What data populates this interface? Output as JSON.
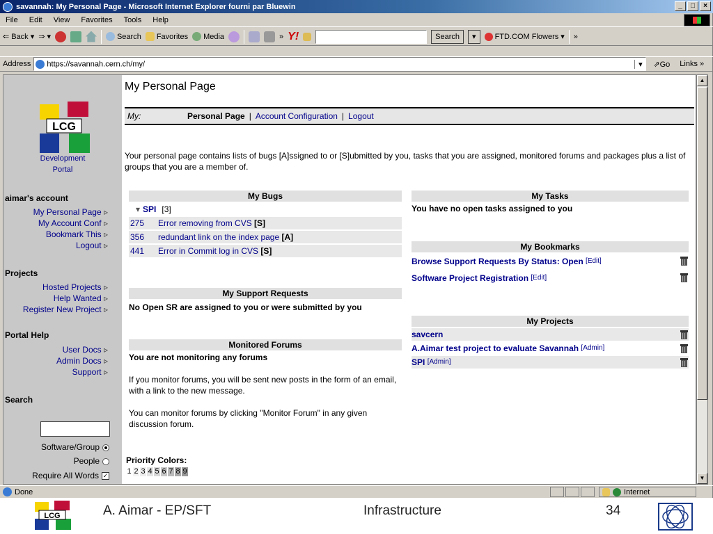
{
  "window": {
    "title": "savannah: My Personal Page - Microsoft Internet Explorer fourni par Bluewin",
    "menu": [
      "File",
      "Edit",
      "View",
      "Favorites",
      "Tools",
      "Help"
    ],
    "toolbar": {
      "back": "Back",
      "search": "Search",
      "favorites": "Favorites",
      "media": "Media",
      "search_button": "Search",
      "flowers": "FTD.COM Flowers"
    },
    "address_label": "Address",
    "address": "https://savannah.cern.ch/my/",
    "go": "Go",
    "links": "Links",
    "status": "Done",
    "zone": "Internet"
  },
  "sidebar": {
    "portal": [
      "Development",
      "Portal"
    ],
    "account_heading": "aimar's account",
    "account_links": [
      "My Personal Page",
      "My Account Conf",
      "Bookmark This",
      "Logout"
    ],
    "projects_heading": "Projects",
    "project_links": [
      "Hosted Projects",
      "Help Wanted",
      "Register New Project"
    ],
    "help_heading": "Portal Help",
    "help_links": [
      "User Docs",
      "Admin Docs",
      "Support"
    ],
    "search_heading": "Search",
    "search_options": [
      "Software/Group",
      "People",
      "Require All Words"
    ]
  },
  "main": {
    "title": "My Personal Page",
    "nav": {
      "label": "My:",
      "current": "Personal Page",
      "links": [
        "Account Configuration",
        "Logout"
      ]
    },
    "intro": "Your personal page contains lists of bugs [A]ssigned to or [S]ubmitted by you, tasks that you are assigned, monitored forums and packages plus a list of groups that you are a member of.",
    "bugs": {
      "heading": "My Bugs",
      "group": "SPI",
      "count": "[3]",
      "rows": [
        {
          "id": "275",
          "text": "Error removing from CVS",
          "tag": "[S]"
        },
        {
          "id": "356",
          "text": "redundant link on the index page",
          "tag": "[A]"
        },
        {
          "id": "441",
          "text": "Error in Commit log in CVS",
          "tag": "[S]"
        }
      ]
    },
    "support": {
      "heading": "My Support Requests",
      "text": "No Open SR are assigned to you or were submitted by you"
    },
    "forums": {
      "heading": "Monitored Forums",
      "text": "You are not monitoring any forums",
      "p1": "If you monitor forums, you will be sent new posts in the form of an email, with a link to the new message.",
      "p2": "You can monitor forums by clicking \"Monitor Forum\" in any given discussion forum."
    },
    "priority": {
      "label": "Priority Colors:",
      "levels": [
        "1",
        "2",
        "3",
        "4",
        "5",
        "6",
        "7",
        "8",
        "9"
      ]
    },
    "tasks": {
      "heading": "My Tasks",
      "text": "You have no open tasks assigned to you"
    },
    "bookmarks": {
      "heading": "My Bookmarks",
      "items": [
        {
          "text": "Browse Support Requests By Status: Open",
          "edit": "[Edit]"
        },
        {
          "text": "Software Project Registration",
          "edit": "[Edit]"
        }
      ]
    },
    "projects": {
      "heading": "My Projects",
      "items": [
        {
          "text": "savcern",
          "admin": ""
        },
        {
          "text": "A.Aimar test project to evaluate Savannah",
          "admin": "[Admin]"
        },
        {
          "text": "SPI",
          "admin": "[Admin]"
        }
      ]
    }
  },
  "footer": {
    "author": "A. Aimar - EP/SFT",
    "topic": "Infrastructure",
    "page": "34"
  },
  "colors": {
    "link": "#00008b",
    "title_bar": "#0a246a",
    "sidebar_bg": "#c8c8c8"
  }
}
